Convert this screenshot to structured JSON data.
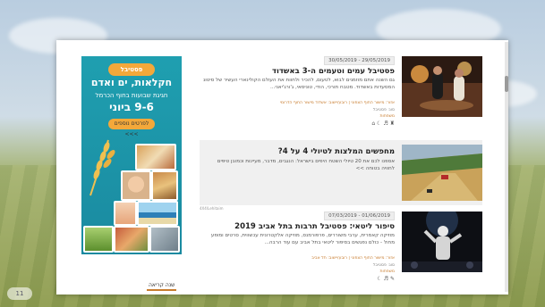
{
  "page_badge": "11",
  "ad": {
    "badge": "פסטיבל",
    "title": "חקלאות, ים ואדם",
    "subtitle": "חגיגת שבועות בחוף הכרמל",
    "dates": "9-6 ביוני",
    "cta": "לפרטים נוספים >>>"
  },
  "articles": [
    {
      "date": "30/05/2019 - 29/05/2019",
      "title": "פסטיבל עמים וטעמים ה-3 באשדוד",
      "desc": "גם השנה אתם מוזמנים לבוא, לטעום, להכיר ולחוות את העולם הקולינארי העשיר של סיטונ המסעדות באשדוד. מטבח תורכי, הודי, טוניסאי, ג'ורג'יאני...",
      "meta1": "אזור: מישור החוף הצפוני | רובע/יישוב: אשדוד מישור החוף הדרומי",
      "meta2": "סוג: פסטיבל",
      "meta3": "משפחות",
      "icons": "♜ ♬ ☾ ⌂"
    },
    {
      "date": "",
      "title": "מחפשים המלצות לטיולי 4 על 4?",
      "desc": "אספנו לכם את 20 טיולי השטח היפים בישראל: הנגבים, מדבר, מעיינות וכמובן טיפים לחוויה בטוחה >>",
      "meta1": "",
      "meta2": "",
      "meta3": "",
      "icons": ""
    },
    {
      "date": "07/03/2019 - 01/06/2019",
      "title": "סיפור ליטאי: פסטיבל תרבות בתל אביב 2019",
      "desc": "מוזיקה קאמרית, ערבי משוררים, פרפורמנס, מוזיקה אלקטרונית עכשווית, סרטים ומופע מחול - כולם נפגשים בסיפור ליטאי בתל אביב עם עוד הרבה...",
      "meta1": "אזור: מישור החוף הצפוני | רובע/יישוב: תל אביב",
      "meta2": "סוג: פסטיבל",
      "meta3": "משפחות",
      "icons": "✎ ♬ ☾"
    }
  ],
  "sponsor_note": "4X4\\Lehitaim",
  "year_tab": "שנה קריאה",
  "colors": {
    "accent": "#c87c2e",
    "ad_bg": "#1f9fb0",
    "ad_highlight": "#f3a83a"
  }
}
